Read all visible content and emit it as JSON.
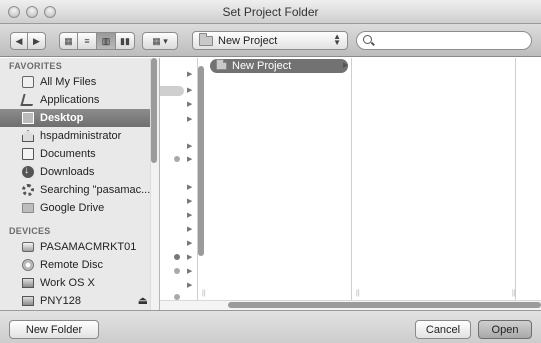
{
  "window": {
    "title": "Set Project Folder"
  },
  "toolbar": {
    "view_modes": [
      "icon-view-icon",
      "list-view-icon",
      "column-view-icon",
      "coverflow-view-icon"
    ],
    "arrange_icon": "grid-icon",
    "location": "New Project",
    "search_placeholder": ""
  },
  "sidebar": {
    "favorites_header": "FAVORITES",
    "favorites": [
      {
        "label": "All My Files",
        "icon": "all-files-icon"
      },
      {
        "label": "Applications",
        "icon": "applications-icon"
      },
      {
        "label": "Desktop",
        "icon": "desktop-icon",
        "selected": true
      },
      {
        "label": "hspadministrator",
        "icon": "home-icon"
      },
      {
        "label": "Documents",
        "icon": "documents-icon"
      },
      {
        "label": "Downloads",
        "icon": "downloads-icon"
      },
      {
        "label": "Searching \"pasamac...",
        "icon": "smart-folder-icon"
      },
      {
        "label": "Google Drive",
        "icon": "folder-icon"
      }
    ],
    "devices_header": "DEVICES",
    "devices": [
      {
        "label": "PASAMACMRKT01",
        "icon": "computer-icon"
      },
      {
        "label": "Remote Disc",
        "icon": "disc-icon"
      },
      {
        "label": "Work OS X",
        "icon": "drive-icon"
      },
      {
        "label": "PNY128",
        "icon": "drive-icon"
      }
    ]
  },
  "browser": {
    "selected_item": "New Project"
  },
  "footer": {
    "new_folder": "New Folder",
    "cancel": "Cancel",
    "open": "Open"
  }
}
